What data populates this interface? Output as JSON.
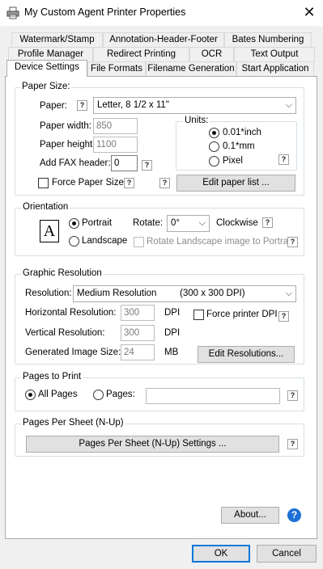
{
  "window": {
    "title": "My Custom Agent Printer Properties",
    "close_glyph": "✕"
  },
  "tabs": {
    "row1": [
      "Watermark/Stamp",
      "Annotation-Header-Footer",
      "Bates Numbering"
    ],
    "row2": [
      "Profile Manager",
      "Redirect Printing",
      "OCR",
      "Text Output"
    ],
    "row3": [
      "Device Settings",
      "File Formats",
      "Filename Generation",
      "Start Application"
    ],
    "active": "Device Settings"
  },
  "paper_size": {
    "group_label": "Paper Size:",
    "paper_label": "Paper:",
    "paper_value": "Letter, 8 1/2 x 11\"",
    "width_label": "Paper width:",
    "width_value": "850",
    "height_label": "Paper height:",
    "height_value": "1100",
    "fax_label": "Add FAX header:",
    "fax_value": "0",
    "force_label": "Force Paper Size",
    "units_label": "Units:",
    "unit_inch": "0.01*inch",
    "unit_mm": "0.1*mm",
    "unit_pixel": "Pixel",
    "edit_button": "Edit paper list ..."
  },
  "orientation": {
    "group_label": "Orientation",
    "portrait": "Portrait",
    "landscape": "Landscape",
    "rotate_label": "Rotate:",
    "rotate_value": "0°",
    "clockwise": "Clockwise",
    "rotate_landscape": "Rotate Landscape image to Portrait",
    "icon_letter": "A"
  },
  "graphic": {
    "group_label": "Graphic Resolution",
    "resolution_label": "Resolution:",
    "resolution_value": "Medium Resolution",
    "resolution_dpi": "(300 x 300 DPI)",
    "horizontal_label": "Horizontal Resolution:",
    "horizontal_value": "300",
    "vertical_label": "Vertical Resolution:",
    "vertical_value": "300",
    "image_size_label": "Generated Image Size:",
    "image_size_value": "24",
    "dpi_unit": "DPI",
    "mb_unit": "MB",
    "force_dpi": "Force printer DPI",
    "edit_button": "Edit Resolutions..."
  },
  "pages": {
    "group_label": "Pages to Print",
    "all_pages": "All Pages",
    "pages": "Pages:",
    "pages_value": ""
  },
  "nup": {
    "group_label": "Pages Per Sheet (N-Up)",
    "button": "Pages Per Sheet (N-Up) Settings ..."
  },
  "footer": {
    "about": "About...",
    "ok": "OK",
    "cancel": "Cancel",
    "help_q": "?"
  },
  "help_glyph": "?",
  "colors": {
    "accent": "#0078d7",
    "help_circle": "#1e6fd6",
    "disabled": "#8d8d8d"
  }
}
